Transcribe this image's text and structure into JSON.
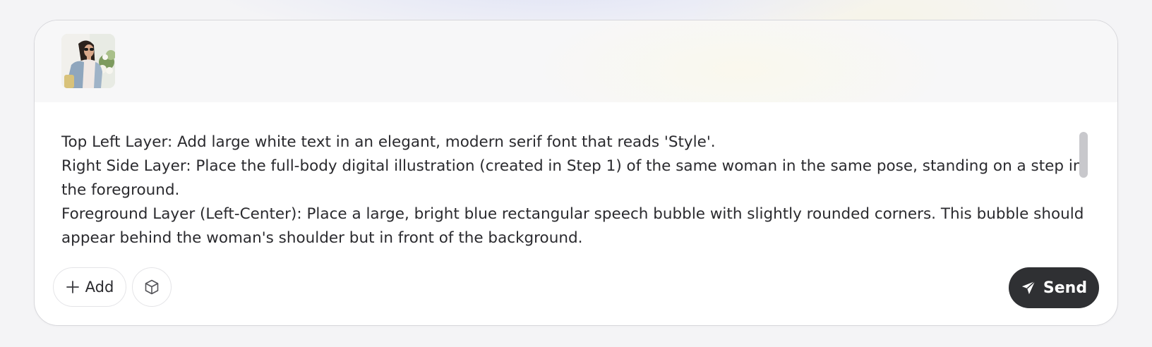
{
  "attachments": [
    {
      "kind": "image",
      "icon": "woman-portrait-thumbnail"
    }
  ],
  "prompt": {
    "lines": [
      "Top Left Layer: Add large white text in an elegant, modern serif font that reads 'Style'.",
      "Right Side Layer: Place the full-body digital illustration (created in Step 1) of the same woman in the same pose, standing on a step in the foreground.",
      "Foreground Layer (Left-Center): Place a large, bright blue rectangular speech bubble with slightly rounded corners. This bubble should appear behind the woman's shoulder but in front of the background."
    ]
  },
  "toolbar": {
    "add_label": "Add",
    "add_icon": "plus-icon",
    "model_icon": "cube-icon",
    "send_label": "Send",
    "send_icon": "paper-plane-icon"
  },
  "colors": {
    "send_button_bg": "#2f3033",
    "text": "#2a2a2e",
    "border": "#d8d8dc"
  }
}
